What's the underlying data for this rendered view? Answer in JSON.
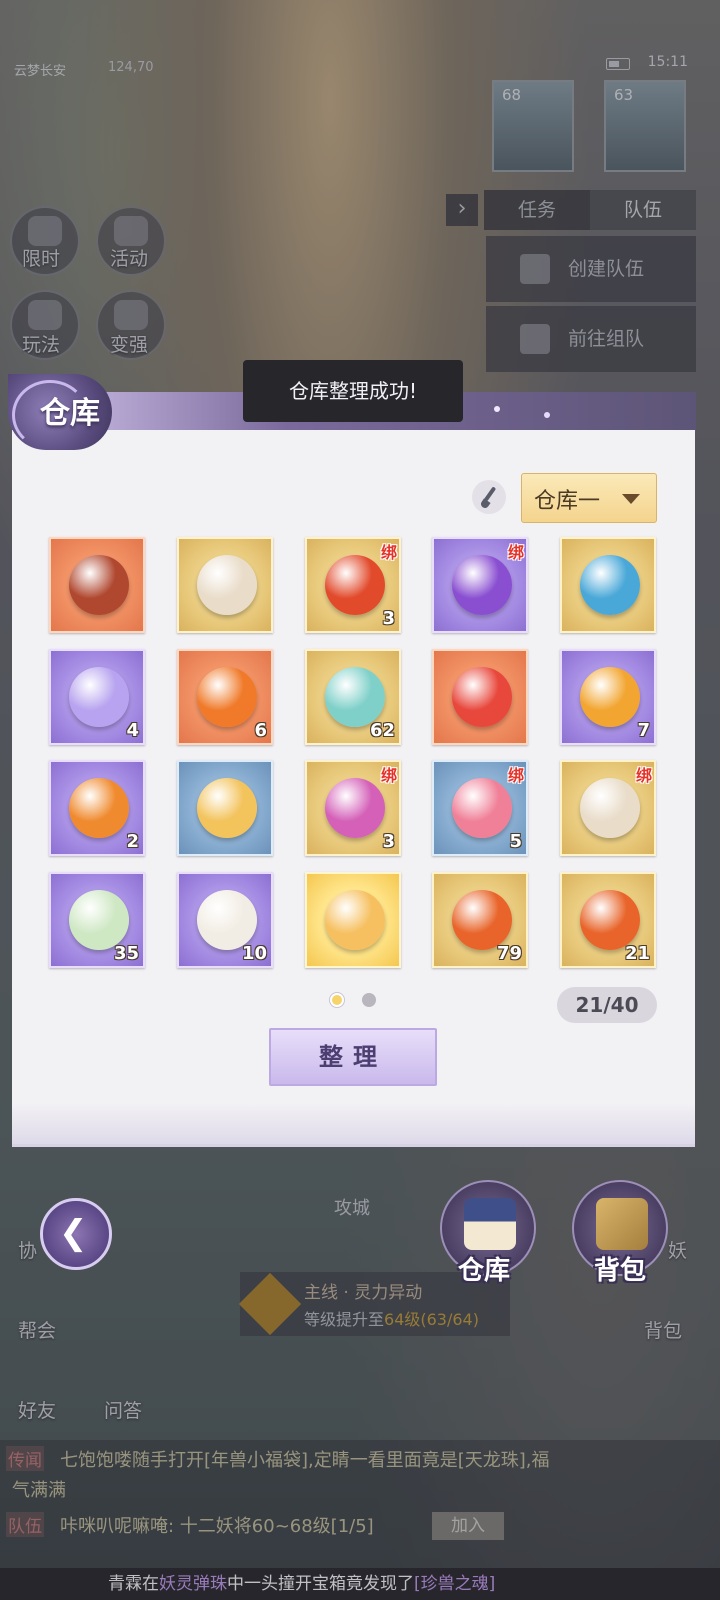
{
  "hud": {
    "location": "云梦长安",
    "coords": "124,70",
    "clock": "15:11",
    "left_buttons": [
      {
        "label": "限时",
        "icon": "clock-icon"
      },
      {
        "label": "活动",
        "icon": "calendar-icon"
      },
      {
        "label": "玩法",
        "icon": "book-icon"
      },
      {
        "label": "变强",
        "icon": "fist-icon"
      }
    ],
    "portraits": [
      {
        "level": "68"
      },
      {
        "level": "63"
      }
    ],
    "team_tabs": [
      "任务",
      "队伍"
    ],
    "team_buttons": [
      "创建队伍",
      "前往组队"
    ]
  },
  "toast": "仓库整理成功!",
  "warehouse": {
    "title": "仓库",
    "selector": "仓库一",
    "page": 1,
    "pages": 2,
    "capacity": "21/40",
    "sort_label": "整理",
    "bound_label": "绑",
    "items": [
      {
        "name": "wooden-box-icon",
        "quality": "red",
        "color": "#b0472f",
        "count": "",
        "bound": false
      },
      {
        "name": "fire-scroll-icon",
        "quality": "gold",
        "color": "#e9dcc9",
        "count": "",
        "bound": false
      },
      {
        "name": "red-orb-icon",
        "quality": "gold",
        "color": "#e24a2c",
        "count": "3",
        "bound": true
      },
      {
        "name": "purple-orb-icon",
        "quality": "purple",
        "color": "#8a4fd1",
        "count": "",
        "bound": true
      },
      {
        "name": "blue-orb-icon",
        "quality": "gold",
        "color": "#4aa8d8",
        "count": "",
        "bound": false
      },
      {
        "name": "lotus-flower-icon",
        "quality": "purple",
        "color": "#b7a3ef",
        "count": "4",
        "bound": false
      },
      {
        "name": "spirit-fruit-icon",
        "quality": "red",
        "color": "#f07a2a",
        "count": "6",
        "bound": false
      },
      {
        "name": "potion-bottle-icon",
        "quality": "gold",
        "color": "#7fd0c9",
        "count": "62",
        "bound": false
      },
      {
        "name": "red-gem-icon",
        "quality": "red",
        "color": "#e8473c",
        "count": "",
        "bound": false
      },
      {
        "name": "amber-crystal-icon",
        "quality": "purple",
        "color": "#f2a530",
        "count": "7",
        "bound": false
      },
      {
        "name": "orange-stone-icon",
        "quality": "purple",
        "color": "#f08a2e",
        "count": "2",
        "bound": false
      },
      {
        "name": "gold-ingot-icon",
        "quality": "blue",
        "color": "#f3c35c",
        "count": "",
        "bound": false
      },
      {
        "name": "rainbow-fruit-icon",
        "quality": "gold",
        "color": "#d460b8",
        "count": "3",
        "bound": true
      },
      {
        "name": "jelly-spoon-icon",
        "quality": "blue",
        "color": "#f08098",
        "count": "5",
        "bound": true
      },
      {
        "name": "fire-scroll-icon",
        "quality": "gold",
        "color": "#e9dcc9",
        "count": "",
        "bound": true
      },
      {
        "name": "green-gourd-icon",
        "quality": "purple",
        "color": "#cfe8c4",
        "count": "35",
        "bound": false
      },
      {
        "name": "white-gourd-icon",
        "quality": "purple",
        "color": "#f2ede4",
        "count": "10",
        "bound": false
      },
      {
        "name": "lucky-cat-ball-icon",
        "quality": "shine",
        "color": "#f6c060",
        "count": "",
        "bound": false
      },
      {
        "name": "fire-orb-cloth-icon",
        "quality": "gold",
        "color": "#e8642a",
        "count": "79",
        "bound": false
      },
      {
        "name": "fire-orb-cloth-icon",
        "quality": "gold",
        "color": "#e8642a",
        "count": "21",
        "bound": false
      }
    ]
  },
  "bottom": {
    "warehouse_label": "仓库",
    "bag_label": "背包",
    "side_labels": [
      "协",
      "帮会",
      "好友",
      "问答",
      "妖",
      "背包"
    ],
    "map_label": "攻城"
  },
  "quest": {
    "title": "主线 · 灵力异动",
    "progress_prefix": "等级提升至",
    "progress_value": "64级(63/64)"
  },
  "chat": {
    "lines": [
      {
        "tag": "传闻",
        "text": "七饱饱喽随手打开[年兽小福袋],定睛一看里面竟是[天龙珠],福"
      },
      {
        "tag": "",
        "text": "气满满"
      },
      {
        "tag": "队伍",
        "text": "咔咪叭呢嘛唵: 十二妖将60~68级[1/5]"
      }
    ],
    "join_label": "加入",
    "marquee_a": "青霖",
    "marquee_b": "在",
    "marquee_c": "妖灵弹珠",
    "marquee_d": "中一头撞开宝箱竟发现了",
    "marquee_e": "[珍兽之魂]"
  }
}
